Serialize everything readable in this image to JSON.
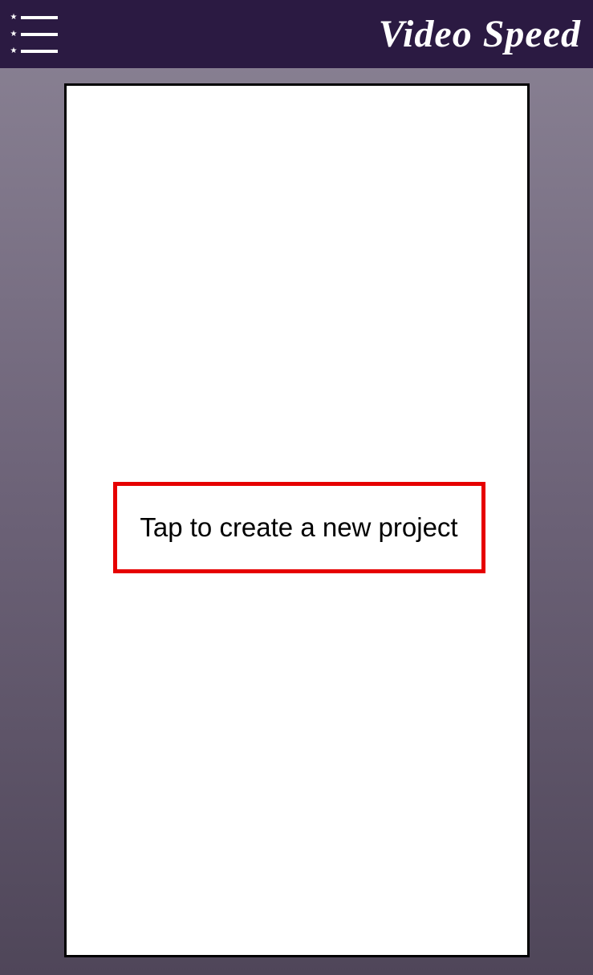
{
  "header": {
    "app_title": "Video Speed"
  },
  "main": {
    "create_project_label": "Tap to create a new project"
  }
}
